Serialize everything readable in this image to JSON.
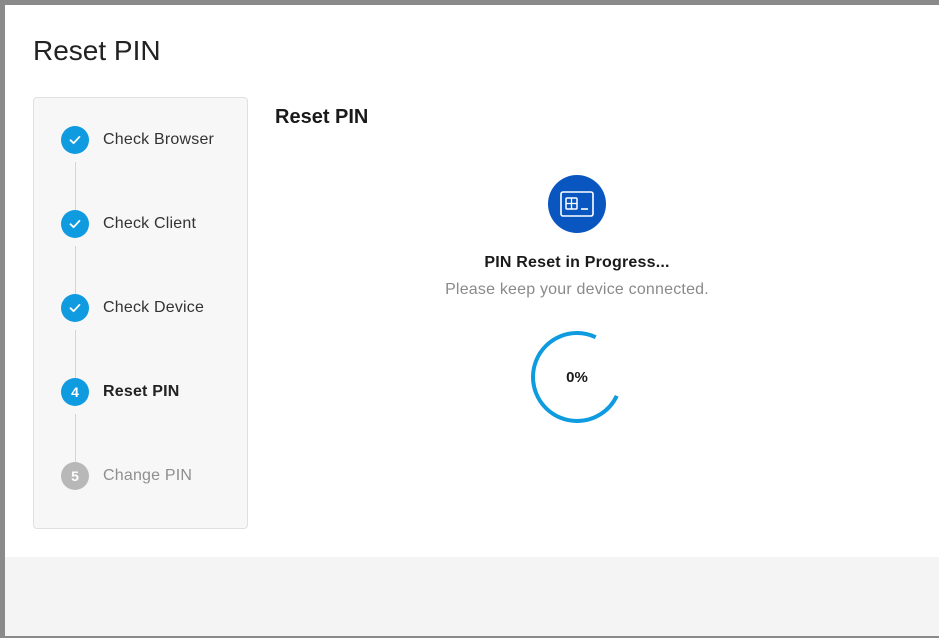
{
  "dialog": {
    "title": "Reset PIN"
  },
  "stepper": {
    "steps": [
      {
        "number": "",
        "label": "Check Browser",
        "state": "done"
      },
      {
        "number": "",
        "label": "Check Client",
        "state": "done"
      },
      {
        "number": "",
        "label": "Check Device",
        "state": "done"
      },
      {
        "number": "4",
        "label": "Reset PIN",
        "state": "active"
      },
      {
        "number": "5",
        "label": "Change PIN",
        "state": "pending"
      }
    ]
  },
  "content": {
    "title": "Reset PIN",
    "icon": "smart-card-icon",
    "status_title": "PIN Reset in Progress...",
    "status_subtitle": "Please keep your device connected.",
    "progress_value": 0,
    "progress_text": "0%"
  },
  "colors": {
    "accent": "#0e9be0",
    "icon_bg": "#0a56c0",
    "pending": "#b8b8b8"
  }
}
